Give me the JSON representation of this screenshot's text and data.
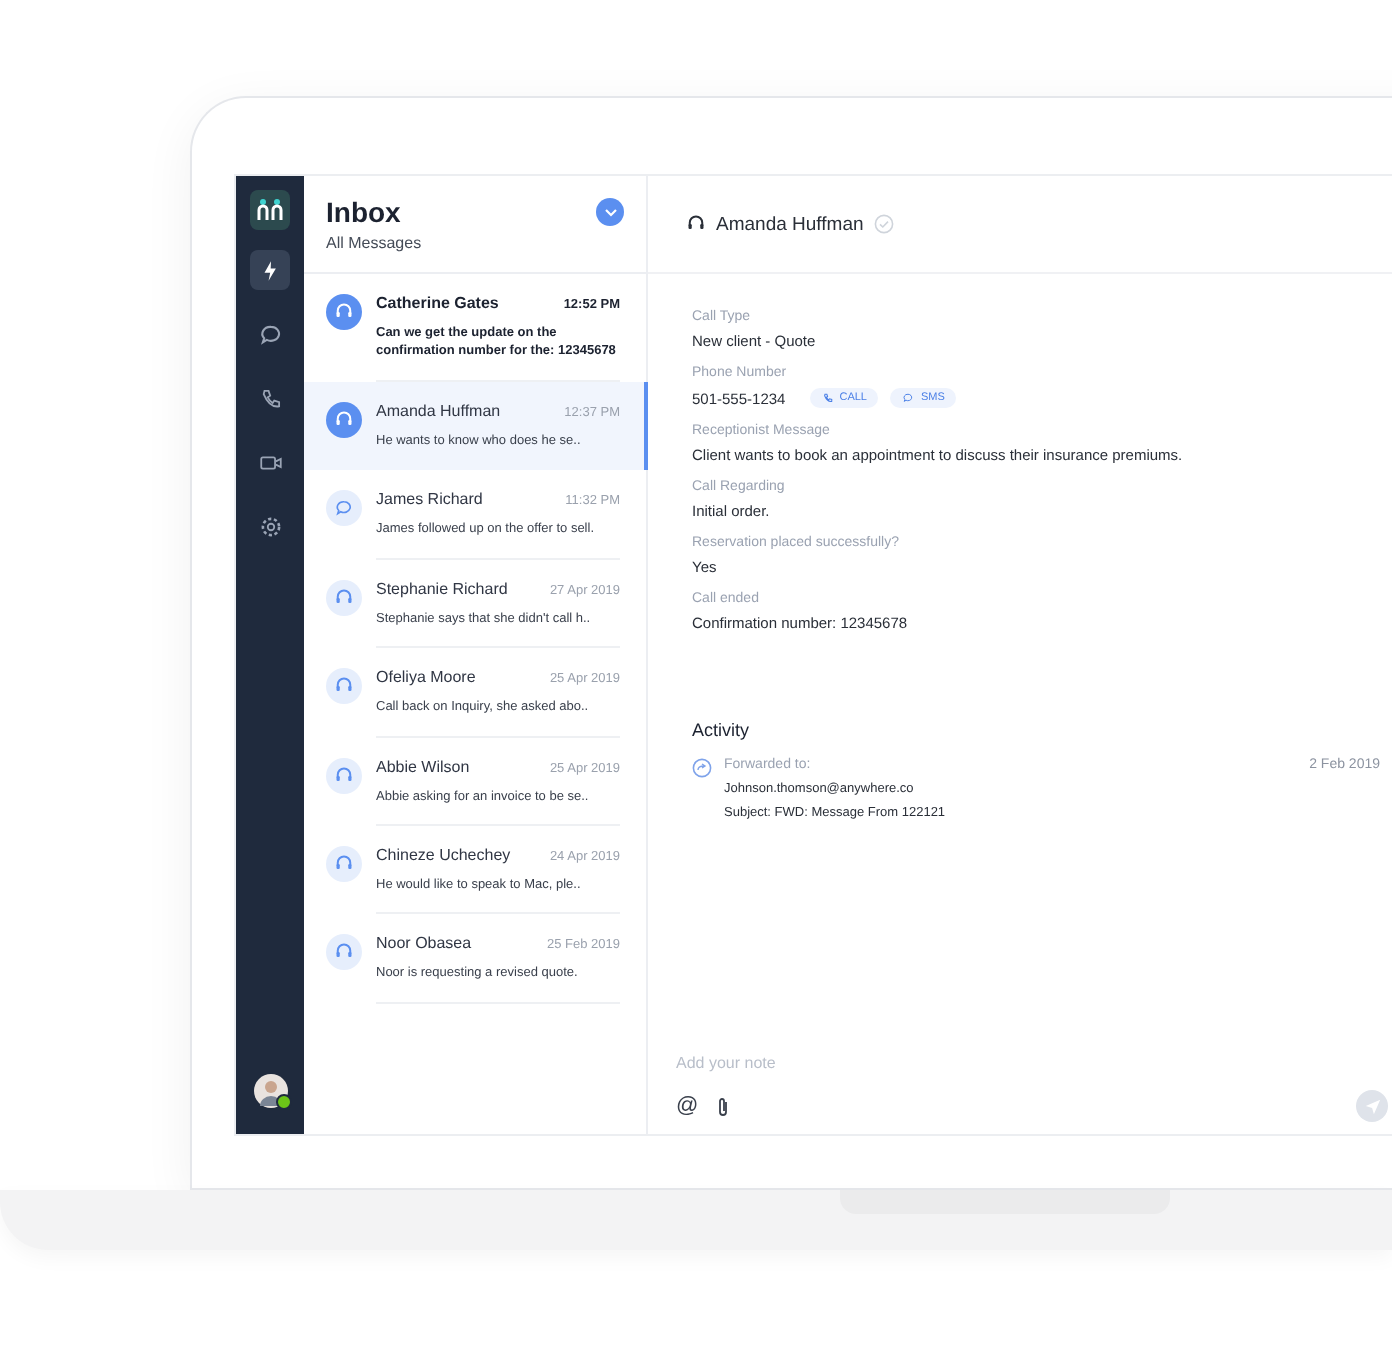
{
  "sidebar": {
    "nav": [
      {
        "selected": true
      },
      {
        "selected": false
      },
      {
        "selected": false
      },
      {
        "selected": false
      },
      {
        "selected": false
      }
    ],
    "user": {
      "online": true
    }
  },
  "inbox": {
    "title": "Inbox",
    "subtitle": "All Messages"
  },
  "messages": [
    {
      "name": "Catherine Gates",
      "time": "12:52 PM",
      "preview": "Can we get the update on the confirmation number for the: 12345678",
      "kind": "call",
      "unread": true,
      "selected": false
    },
    {
      "name": "Amanda Huffman",
      "time": "12:37 PM",
      "preview": "He wants to know who does he se..",
      "kind": "call",
      "unread": false,
      "selected": true
    },
    {
      "name": "James Richard",
      "time": "11:32 PM",
      "preview": "James followed up on the offer to sell.",
      "kind": "chat",
      "unread": false,
      "selected": false
    },
    {
      "name": "Stephanie Richard",
      "time": "27 Apr 2019",
      "preview": "Stephanie says that she didn't call h..",
      "kind": "call",
      "unread": false,
      "selected": false
    },
    {
      "name": "Ofeliya Moore",
      "time": "25 Apr 2019",
      "preview": "Call back on Inquiry, she asked abo..",
      "kind": "call",
      "unread": false,
      "selected": false
    },
    {
      "name": "Abbie Wilson",
      "time": "25 Apr 2019",
      "preview": "Abbie asking for an invoice to be se..",
      "kind": "call",
      "unread": false,
      "selected": false
    },
    {
      "name": "Chineze Uchechey",
      "time": "24 Apr 2019",
      "preview": "He would like to speak to Mac, ple..",
      "kind": "call",
      "unread": false,
      "selected": false
    },
    {
      "name": "Noor Obasea",
      "time": "25 Feb 2019",
      "preview": "Noor is requesting a revised quote.",
      "kind": "call",
      "unread": false,
      "selected": false
    }
  ],
  "detail": {
    "contact": "Amanda Huffman",
    "fields": [
      {
        "label": "Call Type",
        "value": "New client - Quote"
      },
      {
        "label": "Phone Number",
        "value": "501-555-1234",
        "actions": [
          {
            "kind": "call",
            "label": "CALL"
          },
          {
            "kind": "sms",
            "label": "SMS"
          }
        ]
      },
      {
        "label": "Receptionist Message",
        "value": "Client wants to book an appointment to discuss their insurance premiums."
      },
      {
        "label": "Call Regarding",
        "value": "Initial order."
      },
      {
        "label": "Reservation placed successfully?",
        "value": "Yes"
      },
      {
        "label": "Call ended",
        "value": "Confirmation number: 12345678"
      }
    ],
    "activity": {
      "title": "Activity",
      "entries": [
        {
          "action": "Forwarded to:",
          "date": "2 Feb 2019",
          "lines": [
            "Johnson.thomson@anywhere.co",
            "Subject: FWD: Message From 122121"
          ]
        }
      ]
    },
    "note": {
      "placeholder": "Add your note",
      "mention": "@"
    }
  }
}
